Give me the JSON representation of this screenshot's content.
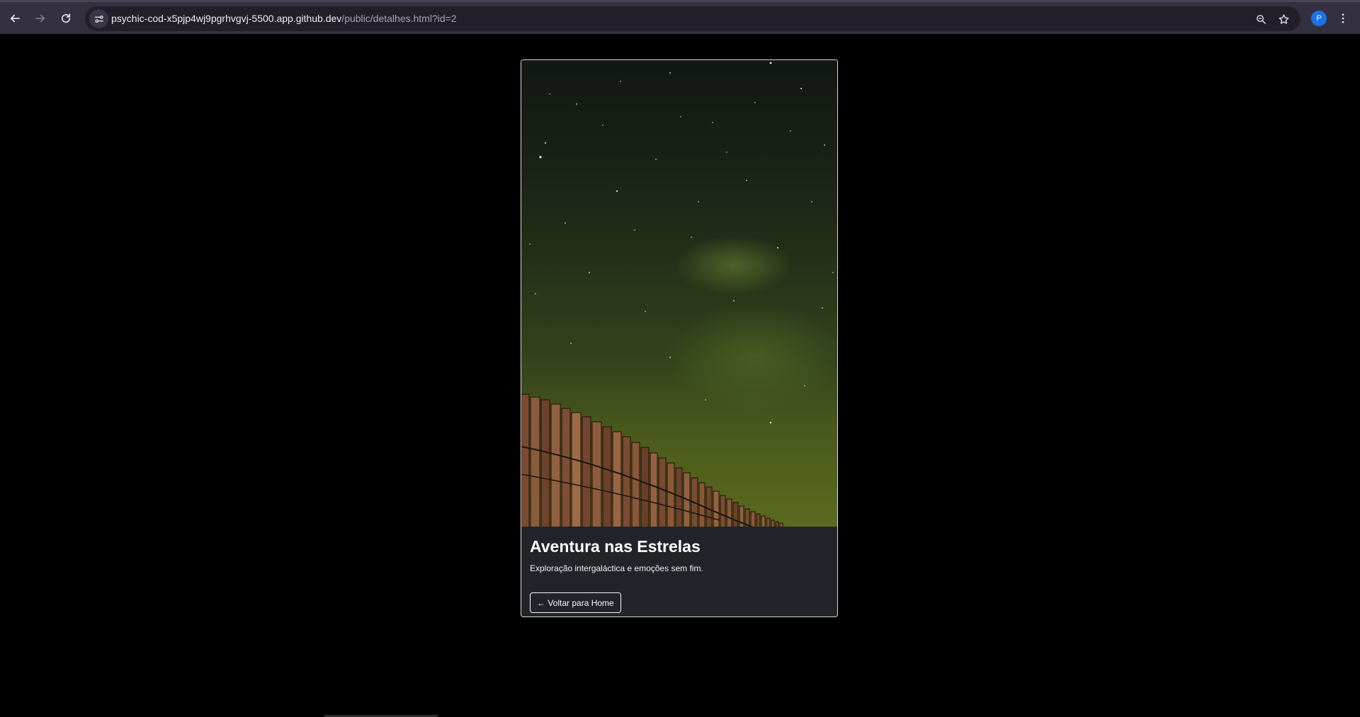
{
  "browser": {
    "url_host": "psychic-cod-x5pjp4wj9pgrhvgvj-5500.app.github.dev",
    "url_path": "/public/detalhes.html?id=2",
    "profile_initial": "P",
    "icons": [
      "back-icon",
      "forward-icon",
      "reload-icon",
      "site-info-icon",
      "zoom-icon",
      "bookmark-star-icon",
      "kebab-menu-icon"
    ]
  },
  "card": {
    "image_icon": "night-sky-fence-image",
    "title": "Aventura nas Estrelas",
    "description": "Exploração intergaláctica e emoções sem fim.",
    "back_button_label": "← Voltar para Home"
  },
  "colors": {
    "page_background": "#000000",
    "card_body": "#212529",
    "chrome": "#35303f",
    "profile": "#1a73e8"
  }
}
